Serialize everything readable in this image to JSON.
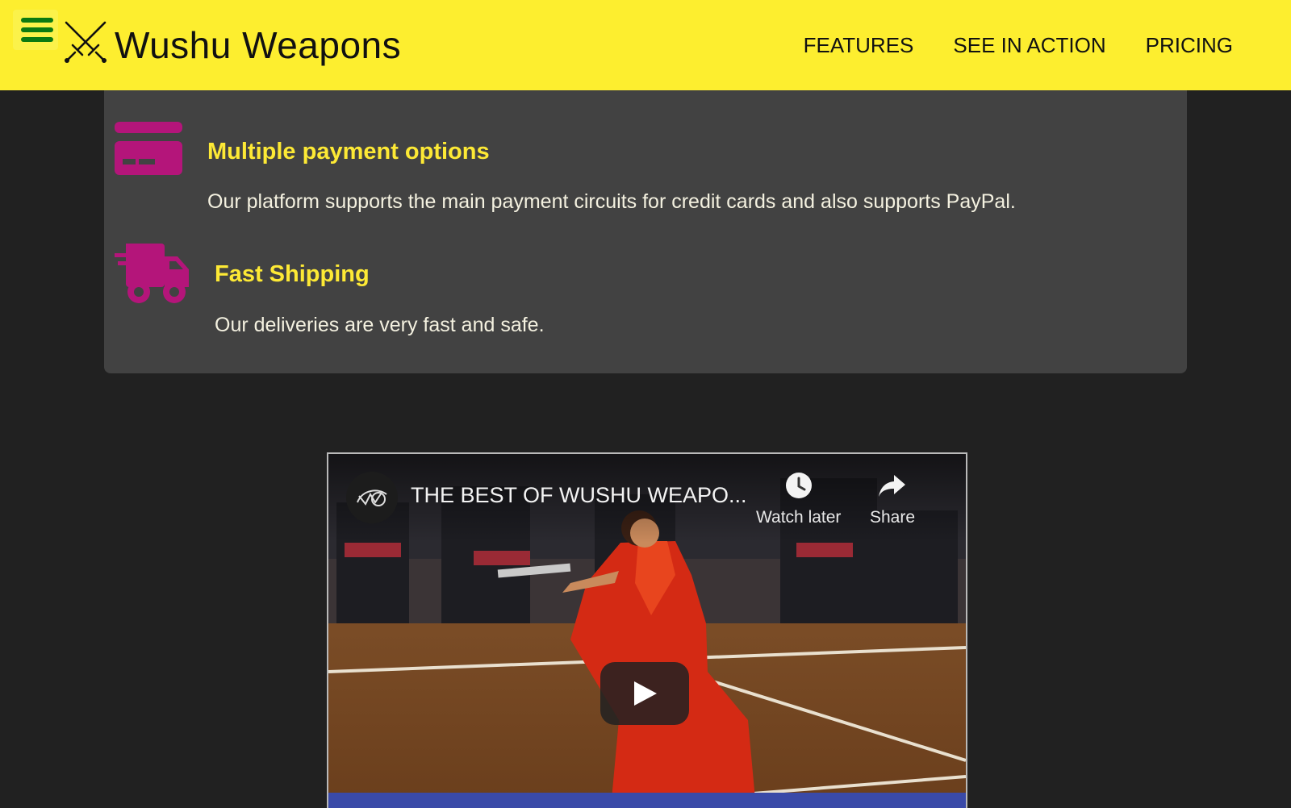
{
  "header": {
    "brand": "Wushu Weapons",
    "nav": [
      "FEATURES",
      "SEE IN ACTION",
      "PRICING"
    ],
    "colors": {
      "background": "#fdee2f",
      "menu_icon": "#0b7a11"
    }
  },
  "features": [
    {
      "icon": "credit-card-icon",
      "title": "Multiple payment options",
      "text": "Our platform supports the main payment circuits for credit cards and also supports PayPal."
    },
    {
      "icon": "shipping-truck-icon",
      "title": "Fast Shipping",
      "text": "Our deliveries are very fast and safe."
    }
  ],
  "colors": {
    "page_bg": "#212121",
    "card_bg": "#424242",
    "title": "#fde935",
    "icon": "#b4157a"
  },
  "video": {
    "title": "THE BEST OF WUSHU WEAPO...",
    "watch_later": "Watch later",
    "share": "Share"
  }
}
